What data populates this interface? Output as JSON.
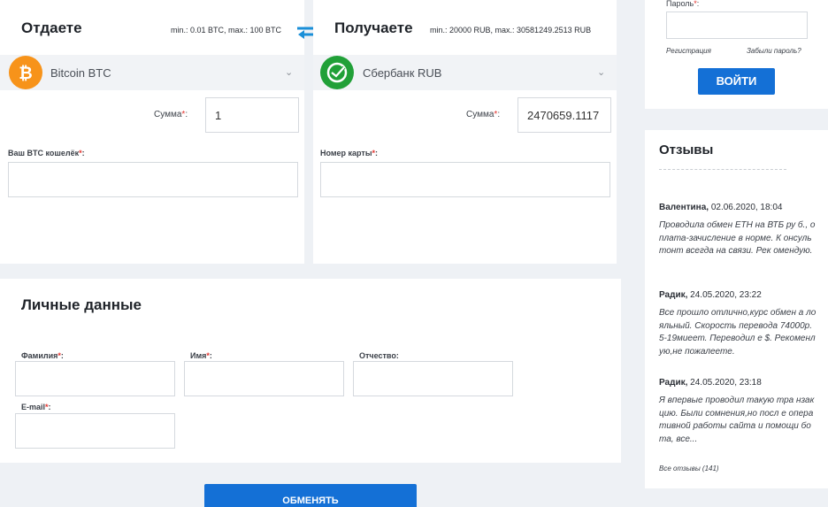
{
  "give": {
    "title": "Отдаете",
    "limits": "min.: 0.01 BTC, max.: 100 BTC",
    "currency": "Bitcoin BTC",
    "currency_icon": "bitcoin-icon",
    "amount_label": "Сумма",
    "amount_value": "1",
    "wallet_label": "Ваш BTC кошелёк",
    "wallet_value": ""
  },
  "receive": {
    "title": "Получаете",
    "limits": "min.: 20000 RUB, max.: 30581249.2513 RUB",
    "currency": "Сбербанк RUB",
    "currency_icon": "sberbank-icon",
    "amount_label": "Сумма",
    "amount_value": "2470659.1117",
    "card_label": "Номер карты",
    "card_value": ""
  },
  "swap_icon": "swap-arrows-icon",
  "required_mark": "*",
  "label_colon": ":",
  "personal": {
    "title": "Личные данные",
    "surname_label": "Фамилия",
    "name_label": "Имя",
    "patronymic_label": "Отчество:",
    "email_label": "E-mail"
  },
  "exchange_button": "ОБМЕНЯТЬ",
  "login": {
    "password_label": "Пароль",
    "register_link": "Регистрация",
    "forgot_link": "Забыли пароль?",
    "login_button": "ВОЙТИ"
  },
  "reviews": {
    "title": "Отзывы",
    "items": [
      {
        "author": "Валентина",
        "date": "02.06.2020, 18:04",
        "text": "Проводила обмен ETH на ВТБ ру б., оплата-зачисление в норме. К онсультонт всегда на связи. Рек омендую."
      },
      {
        "author": "Радик",
        "date": "24.05.2020, 23:22",
        "text": "Все прошло отлично,курс обмен а лояльный. Скорость перевода 74000р. 5-19миеет. Переводил е $. Рекоменлую,не пожалеете."
      },
      {
        "author": "Радик",
        "date": "24.05.2020, 23:18",
        "text": "Я впервые проводил такую тра нзакцию. Были сомнения,но посл е оперативной работы сайта и помощи бота, все..."
      }
    ],
    "all_link": "Все отзывы (141)"
  },
  "colors": {
    "accent": "#1470d6",
    "bitcoin": "#f7931a",
    "sberbank": "#21a038",
    "required": "#e3342f"
  }
}
